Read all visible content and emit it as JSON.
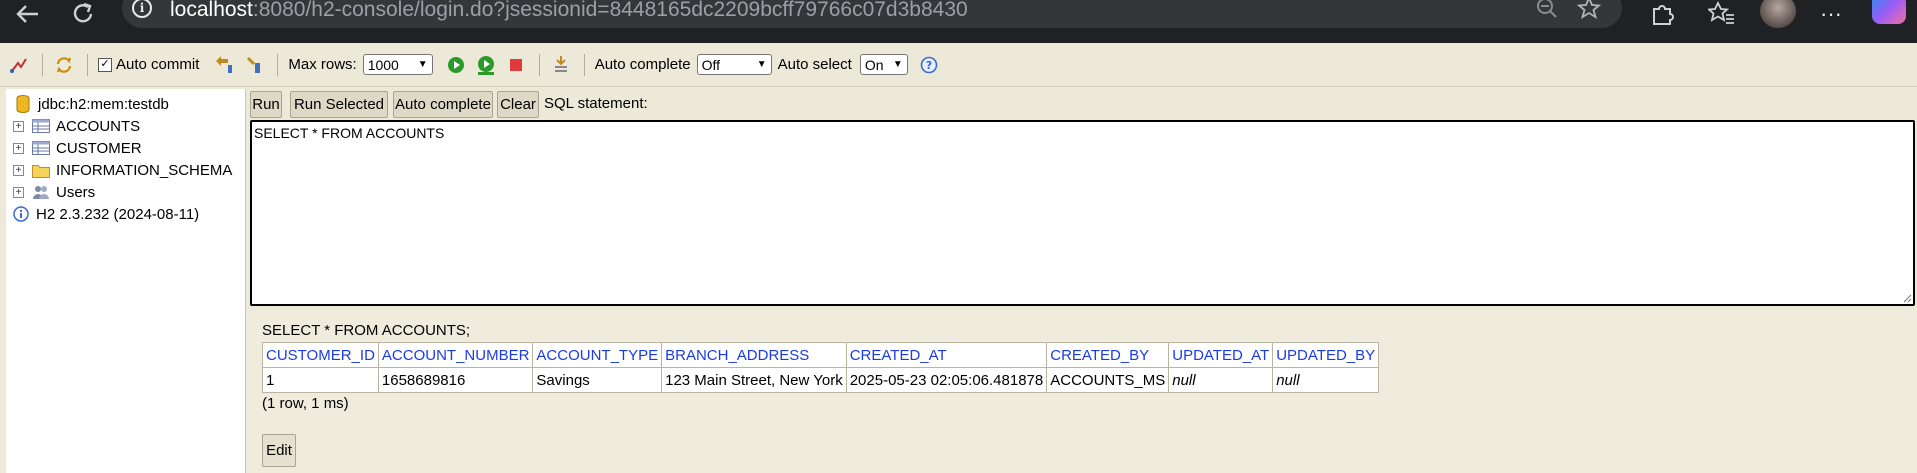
{
  "browser": {
    "url_host": "localhost",
    "url_rest": ":8080/h2-console/login.do?jsessionid=8448165dc2209bcff79766c07d3b8430",
    "icons": [
      "back-icon",
      "reload-icon",
      "site-info-icon",
      "zoom-out-icon",
      "star-icon",
      "extensions-icon",
      "favorites-icon",
      "profile-avatar",
      "more-icon",
      "copilot-icon"
    ]
  },
  "toolbar": {
    "auto_commit_label": "Auto commit",
    "auto_commit_checked": true,
    "max_rows_label": "Max rows:",
    "max_rows_value": "1000",
    "auto_complete_label": "Auto complete",
    "auto_complete_value": "Off",
    "auto_select_label": "Auto select",
    "auto_select_value": "On",
    "help_glyph": "?"
  },
  "tree": {
    "connection": "jdbc:h2:mem:testdb",
    "items": [
      {
        "label": "ACCOUNTS",
        "icon": "table-icon"
      },
      {
        "label": "CUSTOMER",
        "icon": "table-icon"
      },
      {
        "label": "INFORMATION_SCHEMA",
        "icon": "folder-icon"
      },
      {
        "label": "Users",
        "icon": "users-icon"
      }
    ],
    "version": "H2 2.3.232 (2024-08-11)"
  },
  "query": {
    "buttons": {
      "run": "Run",
      "run_selected": "Run Selected",
      "auto_complete": "Auto complete",
      "clear": "Clear"
    },
    "label": "SQL statement:",
    "sql": "SELECT * FROM ACCOUNTS"
  },
  "result": {
    "title": "SELECT * FROM ACCOUNTS;",
    "columns": [
      "CUSTOMER_ID",
      "ACCOUNT_NUMBER",
      "ACCOUNT_TYPE",
      "BRANCH_ADDRESS",
      "CREATED_AT",
      "CREATED_BY",
      "UPDATED_AT",
      "UPDATED_BY"
    ],
    "rows": [
      [
        "1",
        "1658689816",
        "Savings",
        "123 Main Street, New York",
        "2025-05-23 02:05:06.481878",
        "ACCOUNTS_MS",
        "null",
        "null"
      ]
    ],
    "summary": "(1 row, 1 ms)",
    "edit_label": "Edit"
  },
  "colors": {
    "accent_link": "#1a3be8",
    "panel_bg": "#ece9d8",
    "browser_bg": "#202124"
  }
}
